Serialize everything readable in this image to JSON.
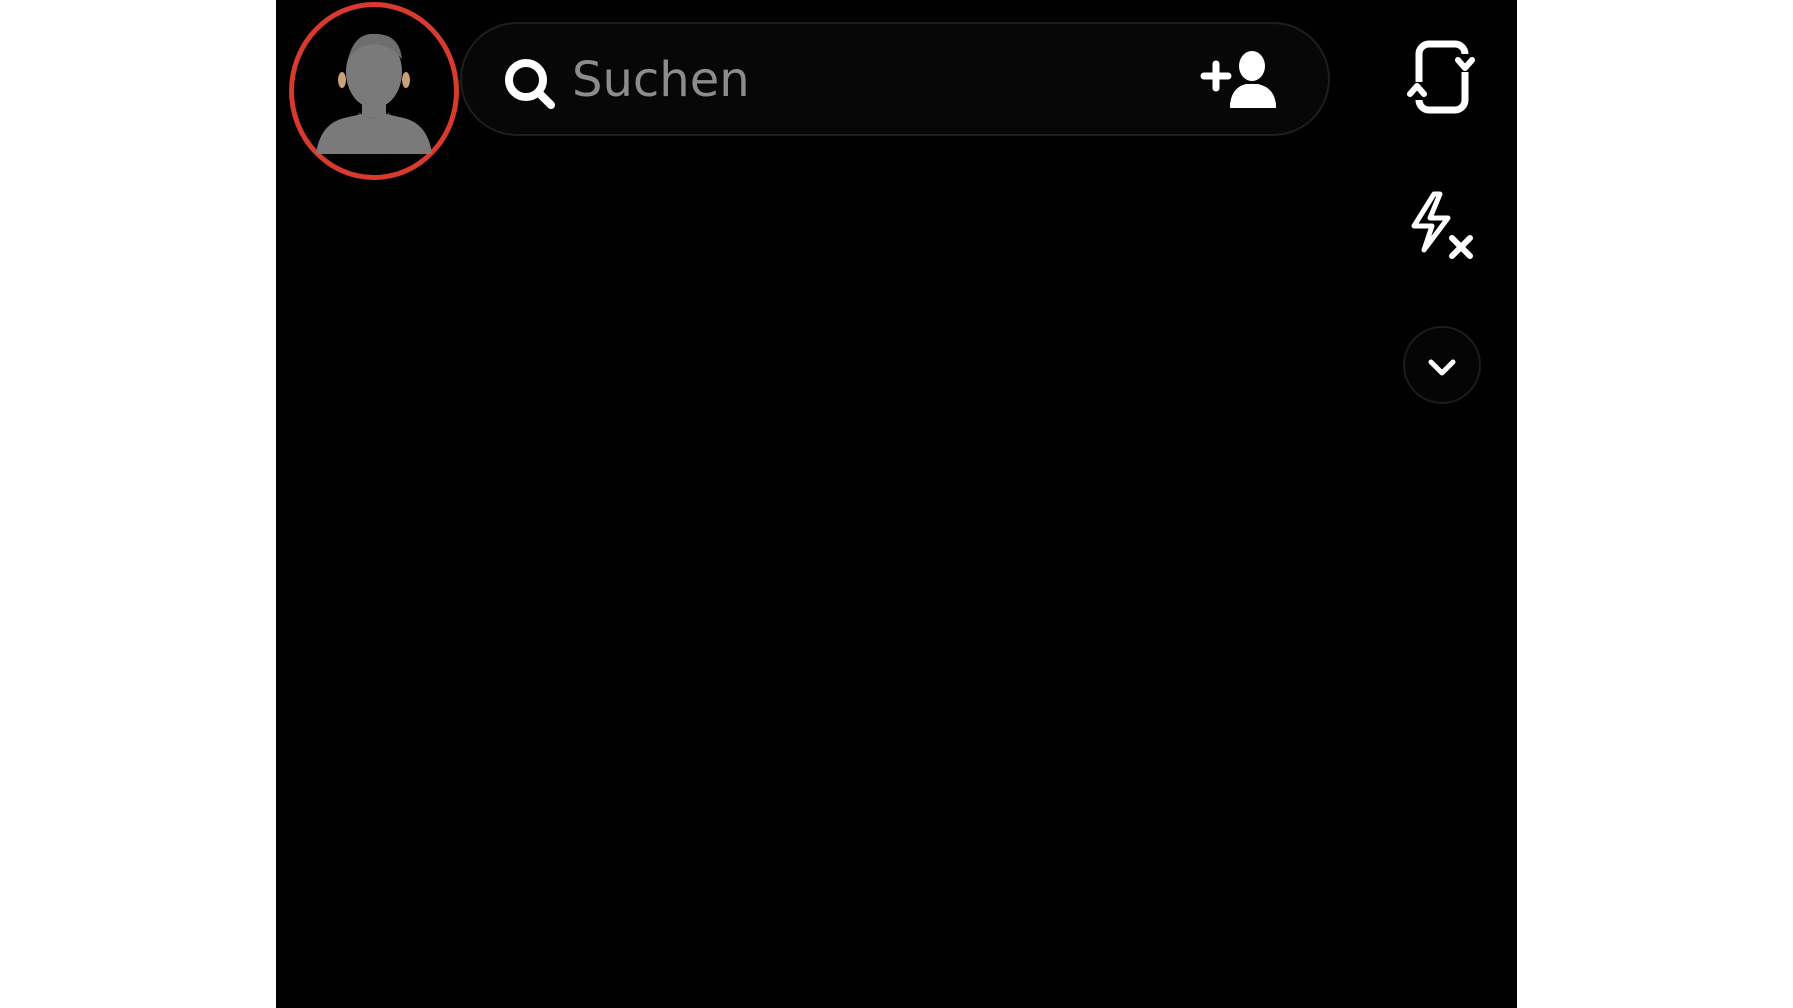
{
  "search": {
    "placeholder": "Suchen"
  },
  "icons": {
    "avatar": "profile-avatar",
    "search": "search-icon",
    "add_friend": "add-friend-icon",
    "flip_camera": "flip-camera-icon",
    "flash": "flash-off-icon",
    "expand": "chevron-down-icon"
  },
  "colors": {
    "background": "#010101",
    "page": "#ffffff",
    "highlight_ring": "#d83a2e",
    "icon": "#ffffff",
    "placeholder": "#8c8c8c",
    "avatar_silhouette": "#7a7a7a"
  }
}
